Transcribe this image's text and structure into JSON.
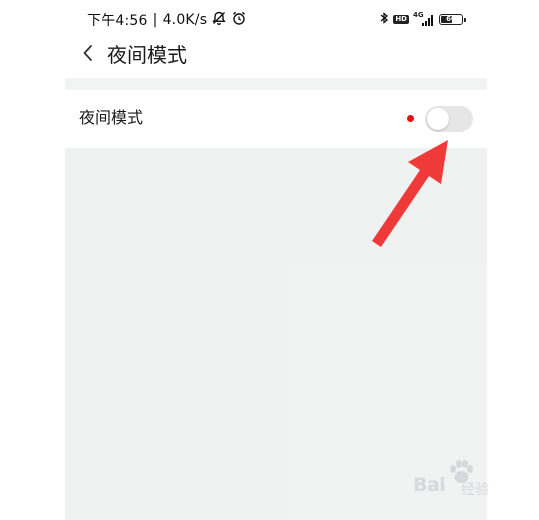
{
  "status_bar": {
    "time": "下午4:56",
    "separator": "|",
    "network_speed": "4.0K/s",
    "icons": [
      "notification-muted-icon",
      "alarm-icon",
      "bluetooth-icon",
      "hd-icon",
      "signal-icon",
      "battery-icon"
    ],
    "hd_label": "HD",
    "network_type": "4G",
    "battery_level": "60"
  },
  "header": {
    "back_icon": "chevron-left-icon",
    "title": "夜间模式"
  },
  "settings": {
    "night_mode": {
      "label": "夜间模式",
      "has_new_indicator": true,
      "enabled": false
    }
  },
  "colors": {
    "indicator_red": "#e8110f",
    "arrow_red": "#f03a3a",
    "toggle_off": "#e6e6e6",
    "page_background": "#f2f3f3"
  },
  "watermark": {
    "brand": "Bai",
    "brand_tail": "经验",
    "icon": "baidu-paw-icon"
  },
  "annotation": {
    "type": "arrow",
    "points_to": "night-mode-toggle"
  }
}
